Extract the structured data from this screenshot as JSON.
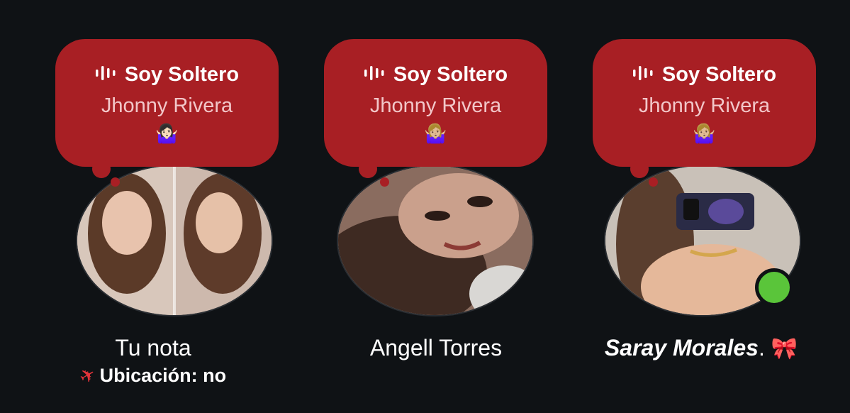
{
  "notes": [
    {
      "song_title": "Soy Soltero",
      "artist": "Jhonny Rivera",
      "emoji": "🤷🏻‍♀️",
      "name": "Tu nota",
      "subtitle": "Ubicación: no",
      "subtitle_icon": "airplane-icon",
      "avatar_description": "two-photo-collage"
    },
    {
      "song_title": "Soy Soltero",
      "artist": "Jhonny Rivera",
      "emoji": "🤷🏼‍♀️",
      "name": "Angell Torres"
    },
    {
      "song_title": "Soy Soltero",
      "artist": "Jhonny Rivera",
      "emoji": "🤷🏼‍♀️",
      "name": "Saray Morales",
      "name_suffix": ".",
      "name_emoji": "🎀",
      "online": true
    }
  ],
  "colors": {
    "background": "#0f1215",
    "bubble": "#a81f24",
    "artist_text": "#f2c7c9",
    "online": "#5ac53a",
    "airplane": "#e3333a"
  }
}
